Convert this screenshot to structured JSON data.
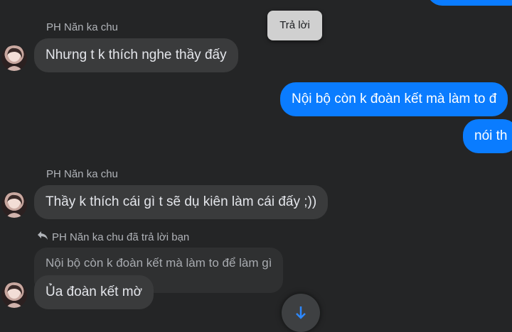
{
  "tooltip": {
    "label": "Trả lời"
  },
  "messages": [
    {
      "sender": "PH Năn ka chu",
      "text": "Nhưng t k thích nghe thầy đấy"
    },
    {
      "text": "Nội bộ còn k đoàn kết mà làm to đ"
    },
    {
      "text": "nói th"
    },
    {
      "sender": "PH Năn ka chu",
      "text": "Thầy k thích cái gì t sẽ dụ kiên làm cái đấy ;))"
    },
    {
      "reply_label": "PH Năn ka chu đã trả lời bạn",
      "quoted_text": "Nội bộ còn k đoàn kết mà làm to để làm gì",
      "text": "Ủa đoàn kết mờ"
    }
  ],
  "icons": {
    "reply": "reply-arrow-icon",
    "scroll": "arrow-down-icon"
  },
  "colors": {
    "background": "#242526",
    "incoming_bubble": "#3a3b3c",
    "outgoing_bubble": "#0a7cff",
    "tooltip": "#d0d0d0"
  }
}
